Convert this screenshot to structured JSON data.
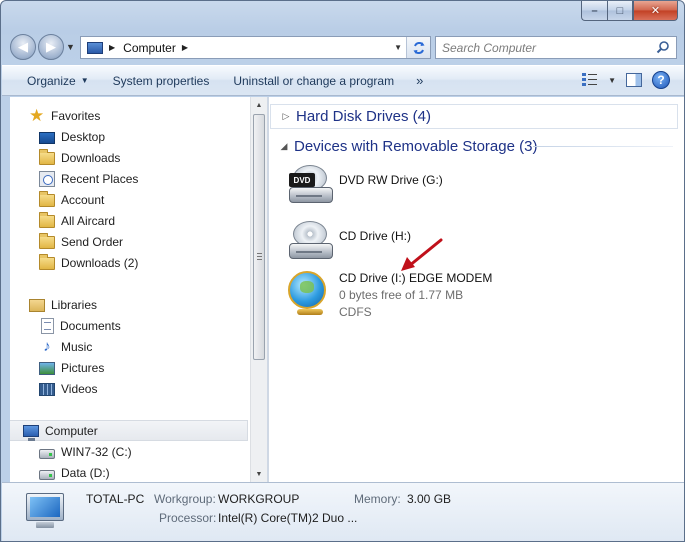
{
  "window": {
    "controls": {
      "minimize": "–",
      "maximize": "□",
      "close": "✕"
    }
  },
  "navigation": {
    "back_icon": "back-arrow-icon",
    "forward_icon": "forward-arrow-icon",
    "address": {
      "crumb": "Computer"
    },
    "search": {
      "placeholder": "Search Computer"
    }
  },
  "toolbar": {
    "organize": "Organize",
    "system_properties": "System properties",
    "uninstall": "Uninstall or change a program",
    "more": "»"
  },
  "sidebar": {
    "favorites": {
      "label": "Favorites",
      "items": [
        {
          "label": "Desktop",
          "icon": "desktop-icon"
        },
        {
          "label": "Downloads",
          "icon": "folder-icon"
        },
        {
          "label": "Recent Places",
          "icon": "recent-places-icon"
        },
        {
          "label": "Account",
          "icon": "folder-icon"
        },
        {
          "label": "All Aircard",
          "icon": "folder-icon"
        },
        {
          "label": "Send Order",
          "icon": "folder-icon"
        },
        {
          "label": "Downloads (2)",
          "icon": "folder-icon"
        }
      ]
    },
    "libraries": {
      "label": "Libraries",
      "items": [
        {
          "label": "Documents",
          "icon": "documents-icon"
        },
        {
          "label": "Music",
          "icon": "music-icon"
        },
        {
          "label": "Pictures",
          "icon": "pictures-icon"
        },
        {
          "label": "Videos",
          "icon": "videos-icon"
        }
      ]
    },
    "computer": {
      "label": "Computer",
      "items": [
        {
          "label": "WIN7-32 (C:)",
          "icon": "windows-drive-icon"
        },
        {
          "label": "Data (D:)",
          "icon": "drive-icon"
        }
      ]
    }
  },
  "content": {
    "hard_disk_group": "Hard Disk Drives (4)",
    "removable_group": "Devices with Removable Storage (3)",
    "devices": [
      {
        "name": "DVD RW Drive (G:)",
        "icon": "dvd-drive-icon",
        "dvd_label": "DVD"
      },
      {
        "name": "CD Drive (H:)",
        "icon": "cd-drive-icon"
      },
      {
        "name": "CD Drive (I:) EDGE MODEM",
        "free": "0 bytes free of 1.77 MB",
        "fs": "CDFS",
        "icon": "globe-drive-icon"
      }
    ]
  },
  "details": {
    "computer_name": "TOTAL-PC",
    "workgroup_label": "Workgroup:",
    "workgroup_value": "WORKGROUP",
    "memory_label": "Memory:",
    "memory_value": "3.00 GB",
    "processor_label": "Processor:",
    "processor_value": "Intel(R) Core(TM)2 Duo ..."
  },
  "colors": {
    "accent_arrow": "#c0101a",
    "group_title": "#1e3287"
  }
}
